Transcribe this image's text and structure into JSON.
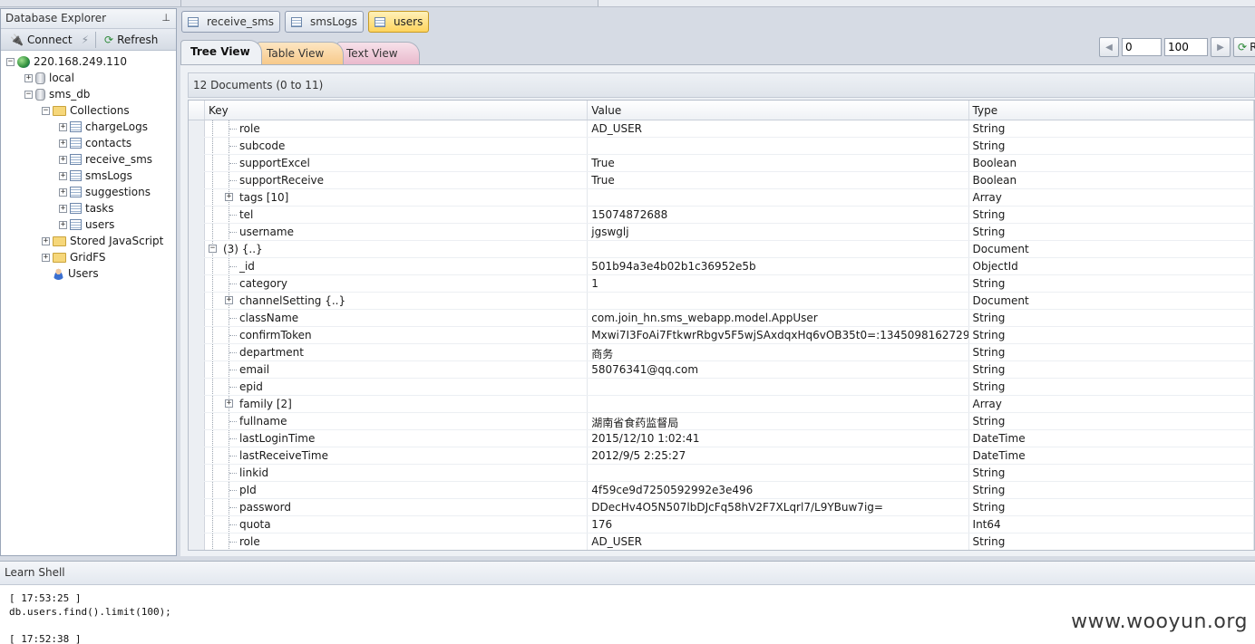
{
  "explorer": {
    "title": "Database Explorer",
    "connect_label": "Connect",
    "refresh_label": "Refresh",
    "tree": {
      "server": "220.168.249.110",
      "local": "local",
      "db": "sms_db",
      "collections_label": "Collections",
      "collections": [
        "chargeLogs",
        "contacts",
        "receive_sms",
        "smsLogs",
        "suggestions",
        "tasks",
        "users"
      ],
      "stored_js": "Stored JavaScript",
      "gridfs": "GridFS",
      "users": "Users"
    }
  },
  "doc_tabs": [
    "receive_sms",
    "smsLogs",
    "users"
  ],
  "active_doc_tab": "users",
  "view_tabs": {
    "tree": "Tree View",
    "table": "Table View",
    "text": "Text View"
  },
  "pager": {
    "skip": "0",
    "limit": "100",
    "refresh_label": "R"
  },
  "summary": "12 Documents (0 to 11)",
  "columns": {
    "key": "Key",
    "value": "Value",
    "type": "Type"
  },
  "rows": [
    {
      "key": "role",
      "value": "AD_USER",
      "type": "String",
      "level": 2,
      "exp": false
    },
    {
      "key": "subcode",
      "value": "",
      "type": "String",
      "level": 2,
      "exp": false
    },
    {
      "key": "supportExcel",
      "value": "True",
      "type": "Boolean",
      "level": 2,
      "exp": false
    },
    {
      "key": "supportReceive",
      "value": "True",
      "type": "Boolean",
      "level": 2,
      "exp": false
    },
    {
      "key": "tags [10]",
      "value": "",
      "type": "Array",
      "level": 2,
      "exp": true
    },
    {
      "key": "tel",
      "value": "15074872688",
      "type": "String",
      "level": 2,
      "exp": false
    },
    {
      "key": "username",
      "value": "jgswglj",
      "type": "String",
      "level": 2,
      "exp": false
    },
    {
      "key": "(3) {..}",
      "value": "",
      "type": "Document",
      "level": 1,
      "exp": true,
      "open": true
    },
    {
      "key": "_id",
      "value": "501b94a3e4b02b1c36952e5b",
      "type": "ObjectId",
      "level": 2,
      "exp": false
    },
    {
      "key": "category",
      "value": "1",
      "type": "String",
      "level": 2,
      "exp": false
    },
    {
      "key": "channelSetting {..}",
      "value": "",
      "type": "Document",
      "level": 2,
      "exp": true
    },
    {
      "key": "className",
      "value": "com.join_hn.sms_webapp.model.AppUser",
      "type": "String",
      "level": 2,
      "exp": false
    },
    {
      "key": "confirmToken",
      "value": "Mxwi7I3FoAi7FtkwrRbgv5F5wjSAxdqxHq6vOB35t0=:1345098162729",
      "type": "String",
      "level": 2,
      "exp": false
    },
    {
      "key": "department",
      "value": "商务",
      "type": "String",
      "level": 2,
      "exp": false
    },
    {
      "key": "email",
      "value": "58076341@qq.com",
      "type": "String",
      "level": 2,
      "exp": false
    },
    {
      "key": "epid",
      "value": "",
      "type": "String",
      "level": 2,
      "exp": false
    },
    {
      "key": "family [2]",
      "value": "",
      "type": "Array",
      "level": 2,
      "exp": true
    },
    {
      "key": "fullname",
      "value": "湖南省食药监督局",
      "type": "String",
      "level": 2,
      "exp": false
    },
    {
      "key": "lastLoginTime",
      "value": "2015/12/10 1:02:41",
      "type": "DateTime",
      "level": 2,
      "exp": false
    },
    {
      "key": "lastReceiveTime",
      "value": "2012/9/5 2:25:27",
      "type": "DateTime",
      "level": 2,
      "exp": false
    },
    {
      "key": "linkid",
      "value": "",
      "type": "String",
      "level": 2,
      "exp": false
    },
    {
      "key": "pId",
      "value": "4f59ce9d7250592992e3e496",
      "type": "String",
      "level": 2,
      "exp": false
    },
    {
      "key": "password",
      "value": "DDecHv4O5N507lbDJcFq58hV2F7XLqrl7/L9YBuw7ig=",
      "type": "String",
      "level": 2,
      "exp": false
    },
    {
      "key": "quota",
      "value": "176",
      "type": "Int64",
      "level": 2,
      "exp": false
    },
    {
      "key": "role",
      "value": "AD_USER",
      "type": "String",
      "level": 2,
      "exp": false
    }
  ],
  "shell": {
    "title": "Learn Shell",
    "lines": [
      "[ 17:53:25 ]",
      "db.users.find().limit(100);",
      "",
      "[ 17:52:38 ]"
    ]
  },
  "watermark": "www.wooyun.org"
}
